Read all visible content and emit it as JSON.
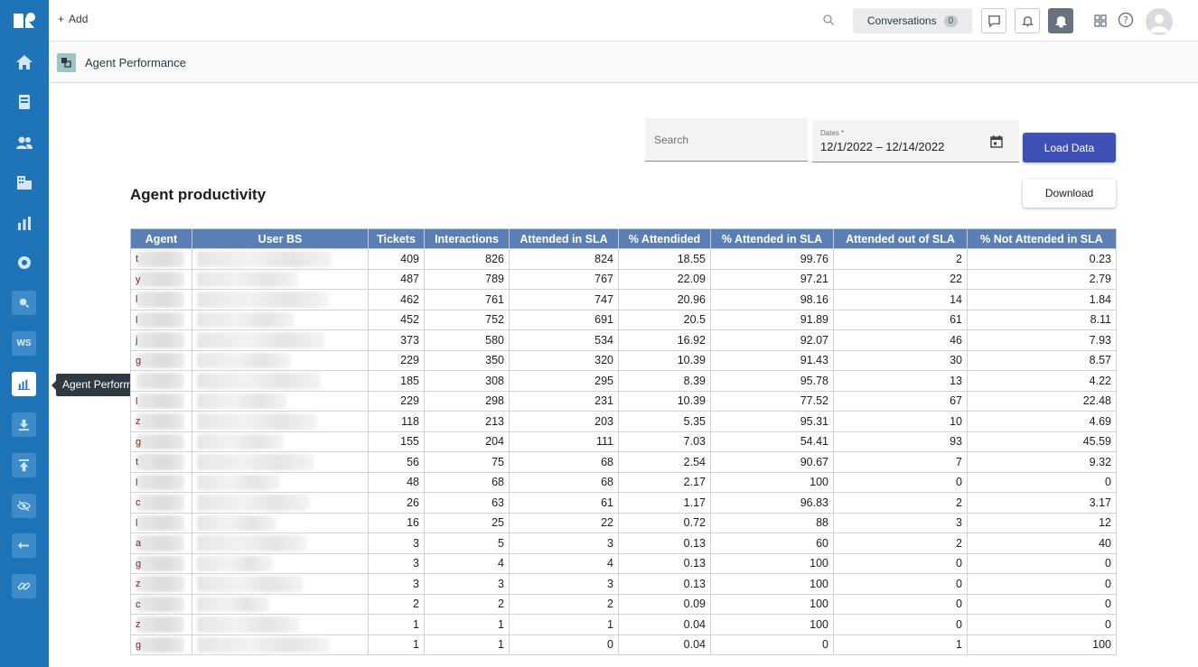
{
  "rail": {
    "tooltip": "Agent Performance",
    "ws_label": "WS"
  },
  "topbar": {
    "add_label": "Add",
    "conversations_label": "Conversations",
    "conversations_count": "0"
  },
  "page": {
    "title": "Agent Performance"
  },
  "filters": {
    "search_placeholder": "Search",
    "dates_label": "Dates *",
    "dates_value": "12/1/2022 – 12/14/2022",
    "load_button": "Load Data",
    "download_button": "Download"
  },
  "section_title": "Agent productivity",
  "table": {
    "headers": [
      "Agent",
      "User BS",
      "Tickets",
      "Interactions",
      "Attended in SLA",
      "% Attendided",
      "% Attended in SLA",
      "Attended out of SLA",
      "% Not Attended in SLA"
    ],
    "rows": [
      {
        "initial": "t",
        "tickets": "409",
        "interactions": "826",
        "in_sla": "824",
        "pct_att": "18.55",
        "pct_in_sla": "99.76",
        "out_sla": "2",
        "pct_not": "0.23"
      },
      {
        "initial": "y",
        "tickets": "487",
        "interactions": "789",
        "in_sla": "767",
        "pct_att": "22.09",
        "pct_in_sla": "97.21",
        "out_sla": "22",
        "pct_not": "2.79"
      },
      {
        "initial": "l",
        "tickets": "462",
        "interactions": "761",
        "in_sla": "747",
        "pct_att": "20.96",
        "pct_in_sla": "98.16",
        "out_sla": "14",
        "pct_not": "1.84"
      },
      {
        "initial": "l",
        "tickets": "452",
        "interactions": "752",
        "in_sla": "691",
        "pct_att": "20.5",
        "pct_in_sla": "91.89",
        "out_sla": "61",
        "pct_not": "8.11"
      },
      {
        "initial": "j",
        "tickets": "373",
        "interactions": "580",
        "in_sla": "534",
        "pct_att": "16.92",
        "pct_in_sla": "92.07",
        "out_sla": "46",
        "pct_not": "7.93"
      },
      {
        "initial": "g",
        "tickets": "229",
        "interactions": "350",
        "in_sla": "320",
        "pct_att": "10.39",
        "pct_in_sla": "91.43",
        "out_sla": "30",
        "pct_not": "8.57"
      },
      {
        "initial": "",
        "tickets": "185",
        "interactions": "308",
        "in_sla": "295",
        "pct_att": "8.39",
        "pct_in_sla": "95.78",
        "out_sla": "13",
        "pct_not": "4.22"
      },
      {
        "initial": "l",
        "tickets": "229",
        "interactions": "298",
        "in_sla": "231",
        "pct_att": "10.39",
        "pct_in_sla": "77.52",
        "out_sla": "67",
        "pct_not": "22.48"
      },
      {
        "initial": "z",
        "tickets": "118",
        "interactions": "213",
        "in_sla": "203",
        "pct_att": "5.35",
        "pct_in_sla": "95.31",
        "out_sla": "10",
        "pct_not": "4.69"
      },
      {
        "initial": "g",
        "tickets": "155",
        "interactions": "204",
        "in_sla": "111",
        "pct_att": "7.03",
        "pct_in_sla": "54.41",
        "out_sla": "93",
        "pct_not": "45.59"
      },
      {
        "initial": "t",
        "tickets": "56",
        "interactions": "75",
        "in_sla": "68",
        "pct_att": "2.54",
        "pct_in_sla": "90.67",
        "out_sla": "7",
        "pct_not": "9.32"
      },
      {
        "initial": "l",
        "tickets": "48",
        "interactions": "68",
        "in_sla": "68",
        "pct_att": "2.17",
        "pct_in_sla": "100",
        "out_sla": "0",
        "pct_not": "0"
      },
      {
        "initial": "c",
        "tickets": "26",
        "interactions": "63",
        "in_sla": "61",
        "pct_att": "1.17",
        "pct_in_sla": "96.83",
        "out_sla": "2",
        "pct_not": "3.17"
      },
      {
        "initial": "l",
        "tickets": "16",
        "interactions": "25",
        "in_sla": "22",
        "pct_att": "0.72",
        "pct_in_sla": "88",
        "out_sla": "3",
        "pct_not": "12"
      },
      {
        "initial": "a",
        "tickets": "3",
        "interactions": "5",
        "in_sla": "3",
        "pct_att": "0.13",
        "pct_in_sla": "60",
        "out_sla": "2",
        "pct_not": "40"
      },
      {
        "initial": "g",
        "tickets": "3",
        "interactions": "4",
        "in_sla": "4",
        "pct_att": "0.13",
        "pct_in_sla": "100",
        "out_sla": "0",
        "pct_not": "0"
      },
      {
        "initial": "z",
        "tickets": "3",
        "interactions": "3",
        "in_sla": "3",
        "pct_att": "0.13",
        "pct_in_sla": "100",
        "out_sla": "0",
        "pct_not": "0"
      },
      {
        "initial": "c",
        "tickets": "2",
        "interactions": "2",
        "in_sla": "2",
        "pct_att": "0.09",
        "pct_in_sla": "100",
        "out_sla": "0",
        "pct_not": "0"
      },
      {
        "initial": "z",
        "tickets": "1",
        "interactions": "1",
        "in_sla": "1",
        "pct_att": "0.04",
        "pct_in_sla": "100",
        "out_sla": "0",
        "pct_not": "0"
      },
      {
        "initial": "g",
        "tickets": "1",
        "interactions": "1",
        "in_sla": "0",
        "pct_att": "0.04",
        "pct_in_sla": "0",
        "out_sla": "1",
        "pct_not": "100"
      }
    ]
  },
  "colors": {
    "rail": "#1f73b7",
    "table_header": "#5a7fb5",
    "primary_button": "#3f51b5"
  }
}
